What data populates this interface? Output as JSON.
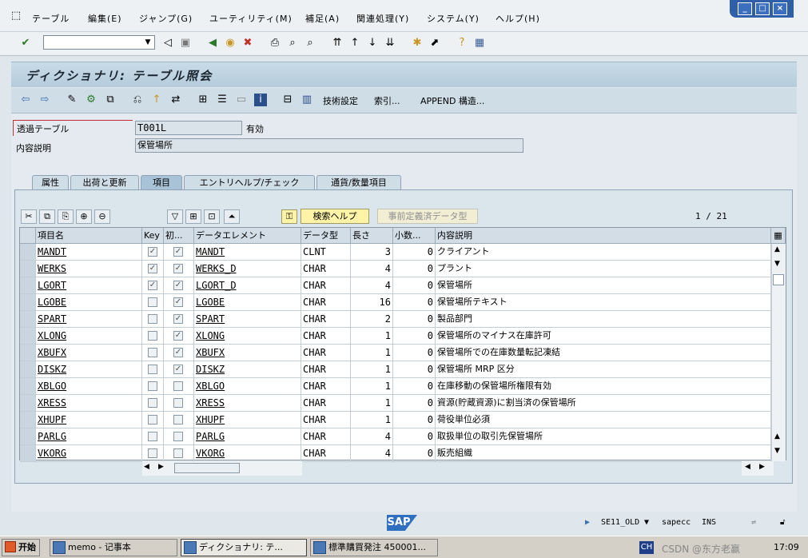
{
  "menu": [
    "テーブル",
    "編集(E)",
    "ジャンプ(G)",
    "ユーティリティ(M)",
    "補足(A)",
    "関連処理(Y)",
    "システム(Y)",
    "ヘルプ(H)"
  ],
  "window_controls": [
    "_",
    "□",
    "×"
  ],
  "title": "ディクショナリ: テーブル照会",
  "app_toolbar": {
    "tech_settings": "技術設定",
    "index": "索引...",
    "append": "APPEND 構造..."
  },
  "form": {
    "table_label": "透過テーブル",
    "table_value": "T001L",
    "status": "有効",
    "desc_label": "内容説明",
    "desc_value": "保管場所"
  },
  "tabs": [
    "属性",
    "出荷と更新",
    "項目",
    "エントリヘルプ/チェック",
    "通貨/数量項目"
  ],
  "active_tab": 2,
  "table_toolbar": {
    "search_help": "検索ヘルプ",
    "predefined_type": "事前定義済データ型",
    "page_indicator": "1 / 21"
  },
  "columns": [
    "項目名",
    "Key",
    "初...",
    "データエレメント",
    "データ型",
    "長さ",
    "小数...",
    "内容説明"
  ],
  "rows": [
    {
      "name": "MANDT",
      "key": true,
      "init": true,
      "element": "MANDT",
      "type": "CLNT",
      "len": "3",
      "dec": "0",
      "desc": "クライアント"
    },
    {
      "name": "WERKS",
      "key": true,
      "init": true,
      "element": "WERKS_D",
      "type": "CHAR",
      "len": "4",
      "dec": "0",
      "desc": "プラント"
    },
    {
      "name": "LGORT",
      "key": true,
      "init": true,
      "element": "LGORT_D",
      "type": "CHAR",
      "len": "4",
      "dec": "0",
      "desc": "保管場所"
    },
    {
      "name": "LGOBE",
      "key": false,
      "init": true,
      "element": "LGOBE",
      "type": "CHAR",
      "len": "16",
      "dec": "0",
      "desc": "保管場所テキスト"
    },
    {
      "name": "SPART",
      "key": false,
      "init": true,
      "element": "SPART",
      "type": "CHAR",
      "len": "2",
      "dec": "0",
      "desc": "製品部門"
    },
    {
      "name": "XLONG",
      "key": false,
      "init": true,
      "element": "XLONG",
      "type": "CHAR",
      "len": "1",
      "dec": "0",
      "desc": "保管場所のマイナス在庫許可"
    },
    {
      "name": "XBUFX",
      "key": false,
      "init": true,
      "element": "XBUFX",
      "type": "CHAR",
      "len": "1",
      "dec": "0",
      "desc": "保管場所での在庫数量転記凍結"
    },
    {
      "name": "DISKZ",
      "key": false,
      "init": true,
      "element": "DISKZ",
      "type": "CHAR",
      "len": "1",
      "dec": "0",
      "desc": "保管場所 MRP 区分"
    },
    {
      "name": "XBLGO",
      "key": false,
      "init": false,
      "element": "XBLGO",
      "type": "CHAR",
      "len": "1",
      "dec": "0",
      "desc": "在庫移動の保管場所権限有効"
    },
    {
      "name": "XRESS",
      "key": false,
      "init": false,
      "element": "XRESS",
      "type": "CHAR",
      "len": "1",
      "dec": "0",
      "desc": "資源(貯蔵資源)に割当済の保管場所"
    },
    {
      "name": "XHUPF",
      "key": false,
      "init": false,
      "element": "XHUPF",
      "type": "CHAR",
      "len": "1",
      "dec": "0",
      "desc": "荷役単位必須"
    },
    {
      "name": "PARLG",
      "key": false,
      "init": false,
      "element": "PARLG",
      "type": "CHAR",
      "len": "4",
      "dec": "0",
      "desc": "取扱単位の取引先保管場所"
    },
    {
      "name": "VKORG",
      "key": false,
      "init": false,
      "element": "VKORG",
      "type": "CHAR",
      "len": "4",
      "dec": "0",
      "desc": "販売組織"
    }
  ],
  "statusbar": {
    "transaction": "SE11_OLD",
    "system": "sapecc",
    "mode": "INS",
    "logo": "SAP"
  },
  "taskbar": {
    "start": "开始",
    "tasks": [
      "memo - 记事本",
      "ディクショナリ: テ...",
      "標準購買発注 450001..."
    ],
    "lang": "CH",
    "watermark": "CSDN @东方老赢",
    "time": "17:09"
  }
}
